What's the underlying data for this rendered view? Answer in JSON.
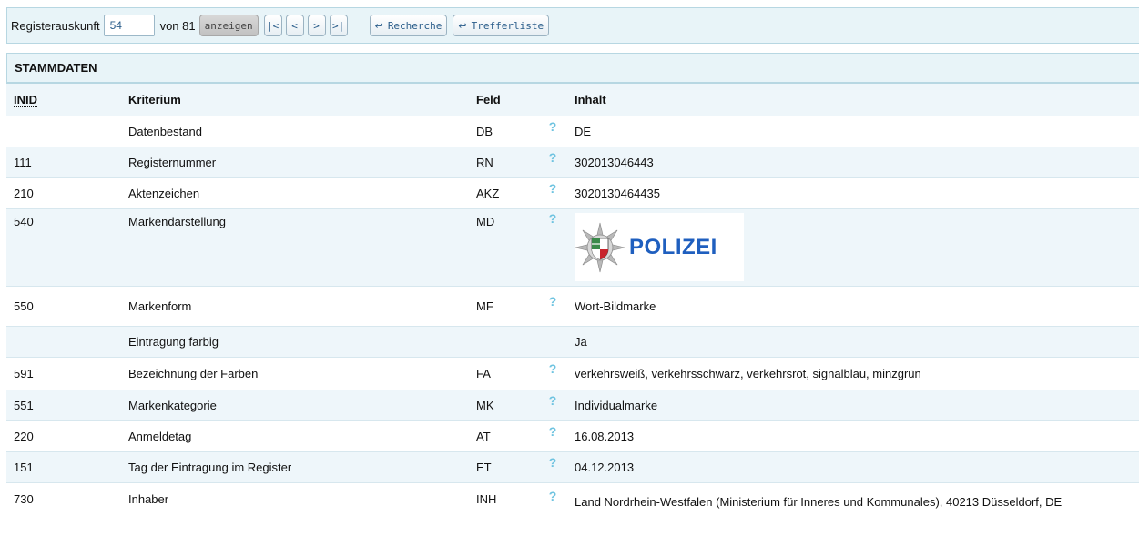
{
  "toolbar": {
    "label": "Registerauskunft",
    "current_value": "54",
    "of_text": "von 81",
    "show_button": "anzeigen",
    "first_button": "|<",
    "prev_button": "<",
    "next_button": ">",
    "last_button": ">|",
    "research_button": "Recherche",
    "hitlist_button": "Trefferliste"
  },
  "section": {
    "title": "STAMMDATEN"
  },
  "table": {
    "headers": {
      "inid": "INID",
      "kriterium": "Kriterium",
      "feld": "Feld",
      "inhalt": "Inhalt"
    },
    "help_glyph": "?",
    "logo_text": "POLIZEI",
    "rows": [
      {
        "inid": "",
        "kriterium": "Datenbestand",
        "feld": "DB",
        "help": "?",
        "inhalt": "DE"
      },
      {
        "inid": "111",
        "kriterium": "Registernummer",
        "feld": "RN",
        "help": "?",
        "inhalt": "302013046443"
      },
      {
        "inid": "210",
        "kriterium": "Aktenzeichen",
        "feld": "AKZ",
        "help": "?",
        "inhalt": "3020130464435"
      },
      {
        "inid": "540",
        "kriterium": "Markendarstellung",
        "feld": "MD",
        "help": "?",
        "inhalt": ""
      },
      {
        "inid": "550",
        "kriterium": "Markenform",
        "feld": "MF",
        "help": "?",
        "inhalt": "Wort-Bildmarke"
      },
      {
        "inid": "",
        "kriterium": "Eintragung farbig",
        "feld": "",
        "help": "",
        "inhalt": "Ja"
      },
      {
        "inid": "591",
        "kriterium": "Bezeichnung der Farben",
        "feld": "FA",
        "help": "?",
        "inhalt": "verkehrsweiß, verkehrsschwarz, verkehrsrot, signalblau, minzgrün"
      },
      {
        "inid": "551",
        "kriterium": "Markenkategorie",
        "feld": "MK",
        "help": "?",
        "inhalt": "Individualmarke"
      },
      {
        "inid": "220",
        "kriterium": "Anmeldetag",
        "feld": "AT",
        "help": "?",
        "inhalt": "16.08.2013"
      },
      {
        "inid": "151",
        "kriterium": "Tag der Eintragung im Register",
        "feld": "ET",
        "help": "?",
        "inhalt": "04.12.2013"
      },
      {
        "inid": "730",
        "kriterium": "Inhaber",
        "feld": "INH",
        "help": "?",
        "inhalt": "Land Nordrhein-Westfalen (Ministerium für Inneres und Kommunales), 40213 Düsseldorf, DE"
      }
    ]
  },
  "icons": {
    "back_arrow": "return-arrow-icon",
    "help": "help-question-icon",
    "logo": "polizei-star-logo"
  },
  "colors": {
    "header_bg": "#e8f4f8",
    "alt_row_bg": "#eef6fa",
    "help_icon": "#6ec3e0",
    "logo_text": "#1f5fbf"
  }
}
